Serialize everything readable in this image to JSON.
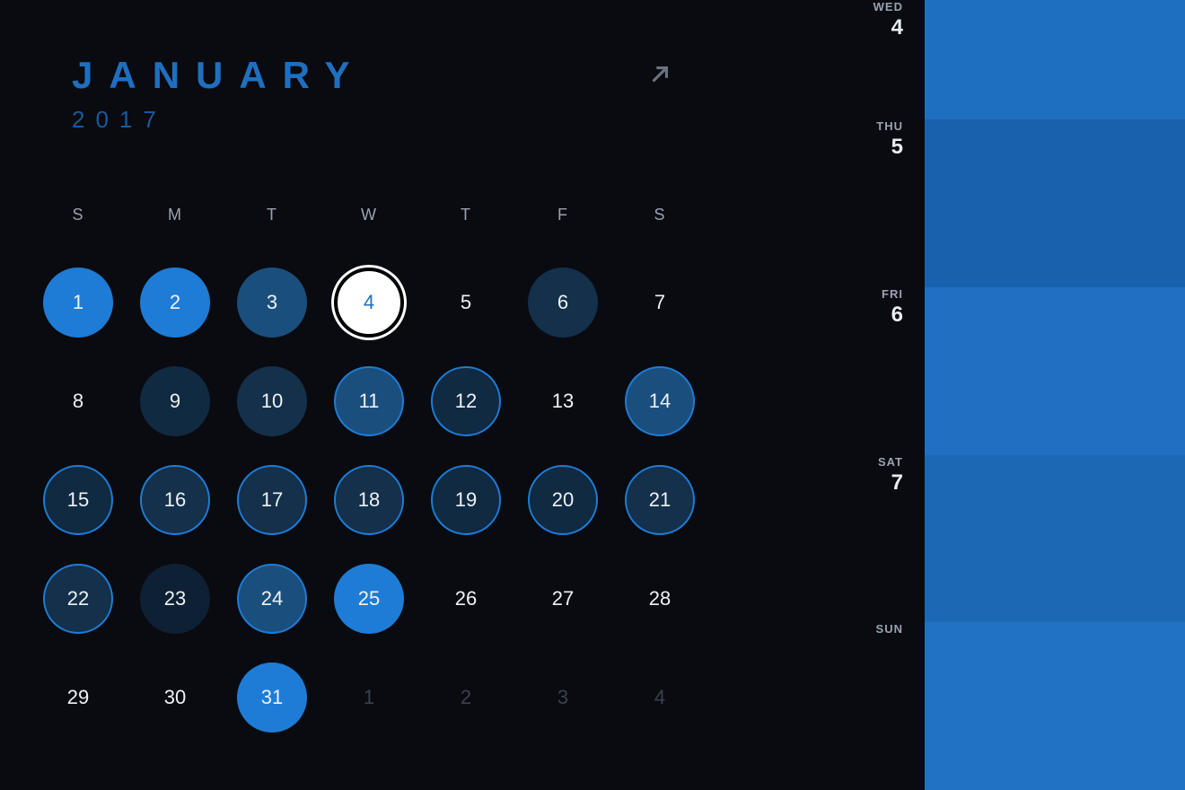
{
  "header": {
    "month": "January",
    "year": "2017",
    "icon": "arrow-up-right"
  },
  "dow": [
    "S",
    "M",
    "T",
    "W",
    "T",
    "F",
    "S"
  ],
  "weeks": [
    [
      {
        "n": "1",
        "heat": 5,
        "outline": false,
        "selected": false,
        "other": false
      },
      {
        "n": "2",
        "heat": 5,
        "outline": false,
        "selected": false,
        "other": false
      },
      {
        "n": "3",
        "heat": 4,
        "outline": false,
        "selected": false,
        "other": false
      },
      {
        "n": "4",
        "heat": 0,
        "outline": false,
        "selected": true,
        "other": false
      },
      {
        "n": "5",
        "heat": 0,
        "outline": false,
        "selected": false,
        "other": false
      },
      {
        "n": "6",
        "heat": 3,
        "outline": false,
        "selected": false,
        "other": false
      },
      {
        "n": "7",
        "heat": 0,
        "outline": false,
        "selected": false,
        "other": false
      }
    ],
    [
      {
        "n": "8",
        "heat": 0,
        "outline": false,
        "selected": false,
        "other": false
      },
      {
        "n": "9",
        "heat": 2,
        "outline": false,
        "selected": false,
        "other": false
      },
      {
        "n": "10",
        "heat": 3,
        "outline": false,
        "selected": false,
        "other": false
      },
      {
        "n": "11",
        "heat": 4,
        "outline": true,
        "selected": false,
        "other": false
      },
      {
        "n": "12",
        "heat": 2,
        "outline": true,
        "selected": false,
        "other": false
      },
      {
        "n": "13",
        "heat": 0,
        "outline": false,
        "selected": false,
        "other": false
      },
      {
        "n": "14",
        "heat": 4,
        "outline": true,
        "selected": false,
        "other": false
      }
    ],
    [
      {
        "n": "15",
        "heat": 2,
        "outline": true,
        "selected": false,
        "other": false
      },
      {
        "n": "16",
        "heat": 3,
        "outline": true,
        "selected": false,
        "other": false
      },
      {
        "n": "17",
        "heat": 3,
        "outline": true,
        "selected": false,
        "other": false
      },
      {
        "n": "18",
        "heat": 3,
        "outline": true,
        "selected": false,
        "other": false
      },
      {
        "n": "19",
        "heat": 2,
        "outline": true,
        "selected": false,
        "other": false
      },
      {
        "n": "20",
        "heat": 2,
        "outline": true,
        "selected": false,
        "other": false
      },
      {
        "n": "21",
        "heat": 3,
        "outline": true,
        "selected": false,
        "other": false
      }
    ],
    [
      {
        "n": "22",
        "heat": 3,
        "outline": true,
        "selected": false,
        "other": false
      },
      {
        "n": "23",
        "heat": 1,
        "outline": false,
        "selected": false,
        "other": false
      },
      {
        "n": "24",
        "heat": 4,
        "outline": true,
        "selected": false,
        "other": false
      },
      {
        "n": "25",
        "heat": 5,
        "outline": false,
        "selected": false,
        "other": false
      },
      {
        "n": "26",
        "heat": 0,
        "outline": false,
        "selected": false,
        "other": false
      },
      {
        "n": "27",
        "heat": 0,
        "outline": false,
        "selected": false,
        "other": false
      },
      {
        "n": "28",
        "heat": 0,
        "outline": false,
        "selected": false,
        "other": false
      }
    ],
    [
      {
        "n": "29",
        "heat": 0,
        "outline": false,
        "selected": false,
        "other": false
      },
      {
        "n": "30",
        "heat": 0,
        "outline": false,
        "selected": false,
        "other": false
      },
      {
        "n": "31",
        "heat": 5,
        "outline": false,
        "selected": false,
        "other": false
      },
      {
        "n": "1",
        "heat": 0,
        "outline": false,
        "selected": false,
        "other": true
      },
      {
        "n": "2",
        "heat": 0,
        "outline": false,
        "selected": false,
        "other": true
      },
      {
        "n": "3",
        "heat": 0,
        "outline": false,
        "selected": false,
        "other": true
      },
      {
        "n": "4",
        "heat": 0,
        "outline": false,
        "selected": false,
        "other": true
      }
    ]
  ],
  "agenda": [
    {
      "abbr": "WED",
      "num": "4"
    },
    {
      "abbr": "THU",
      "num": "5"
    },
    {
      "abbr": "FRI",
      "num": "6"
    },
    {
      "abbr": "SAT",
      "num": "7"
    },
    {
      "abbr": "SUN",
      "num": ""
    }
  ]
}
